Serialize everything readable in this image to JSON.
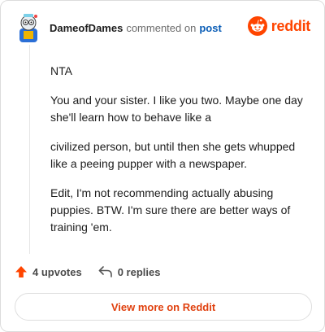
{
  "header": {
    "username": "DameofDames",
    "action": "commented on",
    "post_link": "post"
  },
  "brand": {
    "wordmark": "reddit",
    "color": "#ff4500"
  },
  "comment": {
    "paragraphs": [
      "NTA",
      "You and your sister. I like you two. Maybe one day she'll learn how to behave like a",
      "civilized person, but until then she gets whupped like a peeing pupper with a newspaper.",
      "Edit, I'm not recommending actually abusing puppies. BTW. I'm sure there are better ways of training 'em."
    ]
  },
  "footer": {
    "upvotes": "4 upvotes",
    "replies": "0 replies",
    "upvote_color": "#ff4500"
  },
  "view_more_label": "View more on Reddit",
  "icons": {
    "avatar": "avatar-icon",
    "brand": "reddit-snoo-icon",
    "upvote": "upvote-arrow-icon",
    "reply": "reply-arrow-icon"
  }
}
